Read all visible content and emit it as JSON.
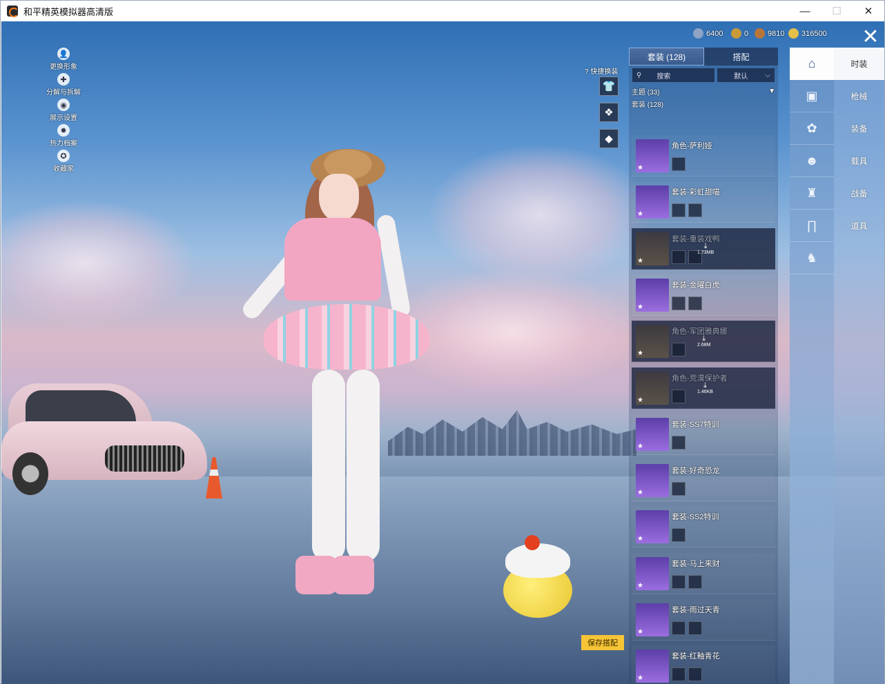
{
  "window": {
    "title": "和平精英模拟器高清版",
    "min": "—",
    "max": "☐",
    "close": "✕"
  },
  "currencies": [
    {
      "icon": "silver-coin-icon",
      "value": "6400",
      "color": "#8fa3c4"
    },
    {
      "icon": "token-icon",
      "value": "0",
      "color": "#c89a3a"
    },
    {
      "icon": "bronze-coin-icon",
      "value": "9810",
      "color": "#b8763a"
    },
    {
      "icon": "gold-coupon-icon",
      "value": "316500",
      "color": "#e2c04a"
    }
  ],
  "left_menu": [
    {
      "icon": "person-icon",
      "glyph": "👤",
      "label": "更换形象"
    },
    {
      "icon": "puzzle-icon",
      "glyph": "✚",
      "label": "分解与拆解"
    },
    {
      "icon": "eye-icon",
      "glyph": "◉",
      "label": "展示设置"
    },
    {
      "icon": "flame-icon",
      "glyph": "✹",
      "label": "热力档案"
    },
    {
      "icon": "trophy-icon",
      "glyph": "✪",
      "label": "收藏家"
    }
  ],
  "quick": {
    "help": "?",
    "label": "快捷换装",
    "buttons": [
      "👕",
      "❖",
      "◆"
    ]
  },
  "tabs": [
    {
      "label": "套装 (128)",
      "active": true
    },
    {
      "label": "搭配",
      "active": false
    }
  ],
  "search": {
    "icon": "⚲",
    "label": "搜索",
    "sort": "默认",
    "sort_arrow": "⌵"
  },
  "sections": {
    "theme": "主题 (33)",
    "theme_arrow": "▼",
    "suits": "套装 (128)"
  },
  "suits": [
    {
      "name": "角色-萨利娅",
      "parts": 1,
      "locked": false
    },
    {
      "name": "套装-彩虹甜喵",
      "parts": 2,
      "locked": false
    },
    {
      "name": "套装-重装戏鸭",
      "parts": 2,
      "locked": true,
      "download": "1.73MB"
    },
    {
      "name": "套装-金曜白虎",
      "parts": 2,
      "locked": false
    },
    {
      "name": "角色-军团雅典娜",
      "parts": 1,
      "locked": true,
      "download": "2.68M"
    },
    {
      "name": "角色-荒漠保护者",
      "parts": 1,
      "locked": true,
      "download": "1.46KB"
    },
    {
      "name": "套装-SS7特训",
      "parts": 1,
      "locked": false
    },
    {
      "name": "套装-好奇恐龙",
      "parts": 1,
      "locked": false
    },
    {
      "name": "套装-SS2特训",
      "parts": 1,
      "locked": false
    },
    {
      "name": "套装-马上来财",
      "parts": 2,
      "locked": false
    },
    {
      "name": "套装-雨过天青",
      "parts": 2,
      "locked": false
    },
    {
      "name": "套装-红釉青花",
      "parts": 2,
      "locked": false
    }
  ],
  "categories": [
    {
      "icon": "hanger-icon",
      "glyph": "⌂",
      "label": "时装",
      "active": true
    },
    {
      "icon": "backpack-icon",
      "glyph": "▣",
      "label": "枪械",
      "active": false
    },
    {
      "icon": "parachute-icon",
      "glyph": "✿",
      "label": "装备",
      "active": false
    },
    {
      "icon": "face-icon",
      "glyph": "☻",
      "label": "载具",
      "active": false
    },
    {
      "icon": "shirt-icon",
      "glyph": "♜",
      "label": "战备",
      "active": false
    },
    {
      "icon": "pants-icon",
      "glyph": "∏",
      "label": "道具",
      "active": false
    },
    {
      "icon": "shoes-icon",
      "glyph": "♞",
      "label": "",
      "active": false
    }
  ],
  "close_glyph": "✕",
  "save_button": "保存搭配"
}
